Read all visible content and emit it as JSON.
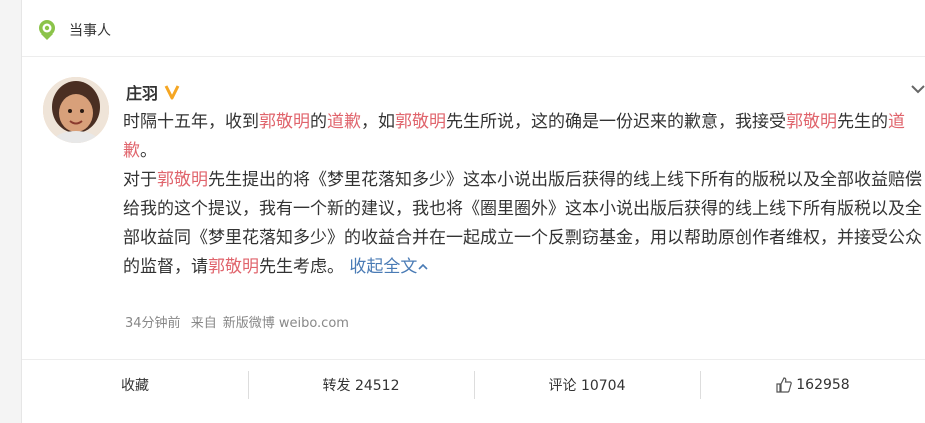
{
  "topic": {
    "title": "当事人"
  },
  "post": {
    "author": "庄羽",
    "paragraph1": [
      {
        "t": "时隔十五年，收到",
        "hl": false
      },
      {
        "t": "郭敬明",
        "hl": true
      },
      {
        "t": "的",
        "hl": false
      },
      {
        "t": "道歉",
        "hl": true
      },
      {
        "t": "，如",
        "hl": false
      },
      {
        "t": "郭敬明",
        "hl": true
      },
      {
        "t": "先生所说，这的确是一份迟来的歉意，我接受",
        "hl": false
      },
      {
        "t": "郭敬明",
        "hl": true
      },
      {
        "t": "先生的",
        "hl": false
      },
      {
        "t": "道歉",
        "hl": true
      },
      {
        "t": "。",
        "hl": false
      }
    ],
    "paragraph2": [
      {
        "t": "对于",
        "hl": false
      },
      {
        "t": "郭敬明",
        "hl": true
      },
      {
        "t": "先生提出的将《梦里花落知多少》这本小说出版后获得的线上线下所有的版税以及全部收益赔偿给我的这个提议，我有一个新的建议，我也将《圈里圈外》这本小说出版后获得的线上线下所有版税以及全部收益同《梦里花落知多少》的收益合并在一起成立一个反剽窃基金，用以帮助原创作者维权，并接受公众的监督，请",
        "hl": false
      },
      {
        "t": "郭敬明",
        "hl": true
      },
      {
        "t": "先生考虑。",
        "hl": false
      }
    ],
    "collapse_label": "收起全文",
    "time": "34分钟前",
    "source_prefix": "来自",
    "source": "新版微博 weibo.com"
  },
  "actions": {
    "favorite": "收藏",
    "repost": "转发 24512",
    "comment": "评论 10704",
    "like": "162958"
  },
  "colors": {
    "highlight": "#e0646c",
    "link": "#4a7bb5"
  }
}
